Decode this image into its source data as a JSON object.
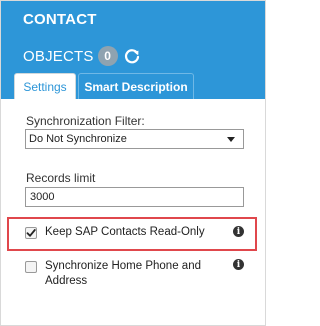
{
  "header": {
    "title": "CONTACT",
    "subtitle": "OBJECTS",
    "count": "0",
    "refresh_icon": "refresh-icon",
    "background_color": "#2d96d8"
  },
  "tabs": [
    {
      "label": "Settings",
      "active": true
    },
    {
      "label": "Smart Description",
      "active": false
    }
  ],
  "settings": {
    "sync_filter": {
      "label": "Synchronization Filter:",
      "value": "Do Not Synchronize"
    },
    "records_limit": {
      "label": "Records limit",
      "value": "3000"
    },
    "options": [
      {
        "label": "Keep SAP Contacts Read-Only",
        "checked": true,
        "highlighted": true,
        "highlight_color": "#e0474c",
        "info_icon": "info-icon"
      },
      {
        "label": "Synchronize Home Phone and Address",
        "checked": false,
        "highlighted": false,
        "info_icon": "info-icon"
      }
    ]
  }
}
